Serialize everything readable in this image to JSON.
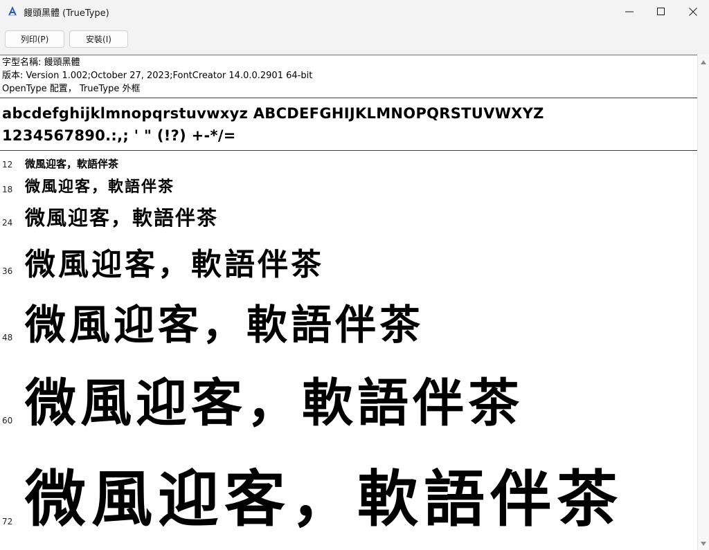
{
  "window": {
    "title": "饅頭黑體 (TrueType)",
    "controls": [
      "minimize-icon",
      "maximize-icon",
      "close-icon"
    ]
  },
  "toolbar": {
    "print_label": "列印(P)",
    "install_label": "安裝(I)"
  },
  "font_info": {
    "name_line": "字型名稱: 饅頭黑體",
    "version_line": "版本: Version 1.002;October 27, 2023;FontCreator 14.0.0.2901 64-bit",
    "outline_line": "OpenType 配置， TrueType 外框"
  },
  "alphabet": {
    "line1": "abcdefghijklmnopqrstuvwxyz ABCDEFGHIJKLMNOPQRSTUVWXYZ",
    "line2": "1234567890.:,; ' \" (!?) +-*/="
  },
  "sample_text": "微風迎客，軟語伴茶",
  "sample_sizes": [
    "12",
    "18",
    "24",
    "36",
    "48",
    "60",
    "72"
  ],
  "colors": {
    "window_bg": "#f3f3f3",
    "content_bg": "#ffffff",
    "text": "#000000"
  }
}
